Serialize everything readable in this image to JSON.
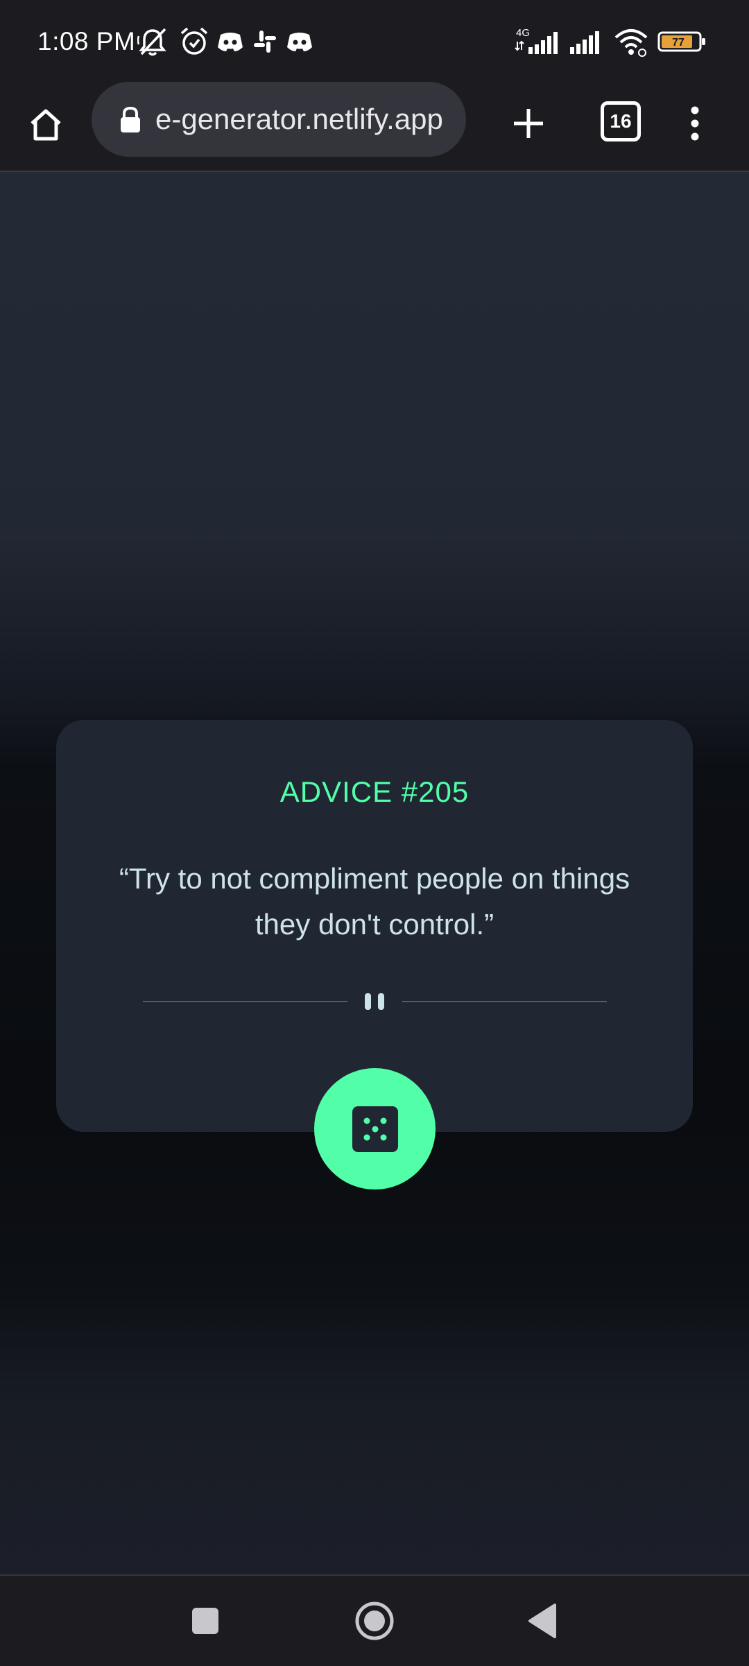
{
  "status_bar": {
    "time": "1:08 PM",
    "battery_level": "77",
    "network_type": "4G",
    "icons": [
      "muted-bell-icon",
      "alarm-icon",
      "discord-icon",
      "slack-icon",
      "discord-icon",
      "signal-icon",
      "signal-icon",
      "wifi-icon",
      "battery-icon"
    ]
  },
  "browser": {
    "url_display": "e-generator.netlify.app",
    "tab_count": "16",
    "icons": [
      "home-icon",
      "lock-icon",
      "new-tab-icon",
      "tabs-icon",
      "more-menu-icon"
    ]
  },
  "advice": {
    "title": "ADVICE #205",
    "quote": "“Try to not compliment people on things they don't control.”",
    "button_icon": "dice-icon"
  },
  "colors": {
    "accent": "#52ffa8",
    "card": "#202733",
    "text": "#cee3e9",
    "divider": "#4f5d74"
  },
  "nav": {
    "icons": [
      "recents-icon",
      "home-icon",
      "back-icon"
    ]
  }
}
